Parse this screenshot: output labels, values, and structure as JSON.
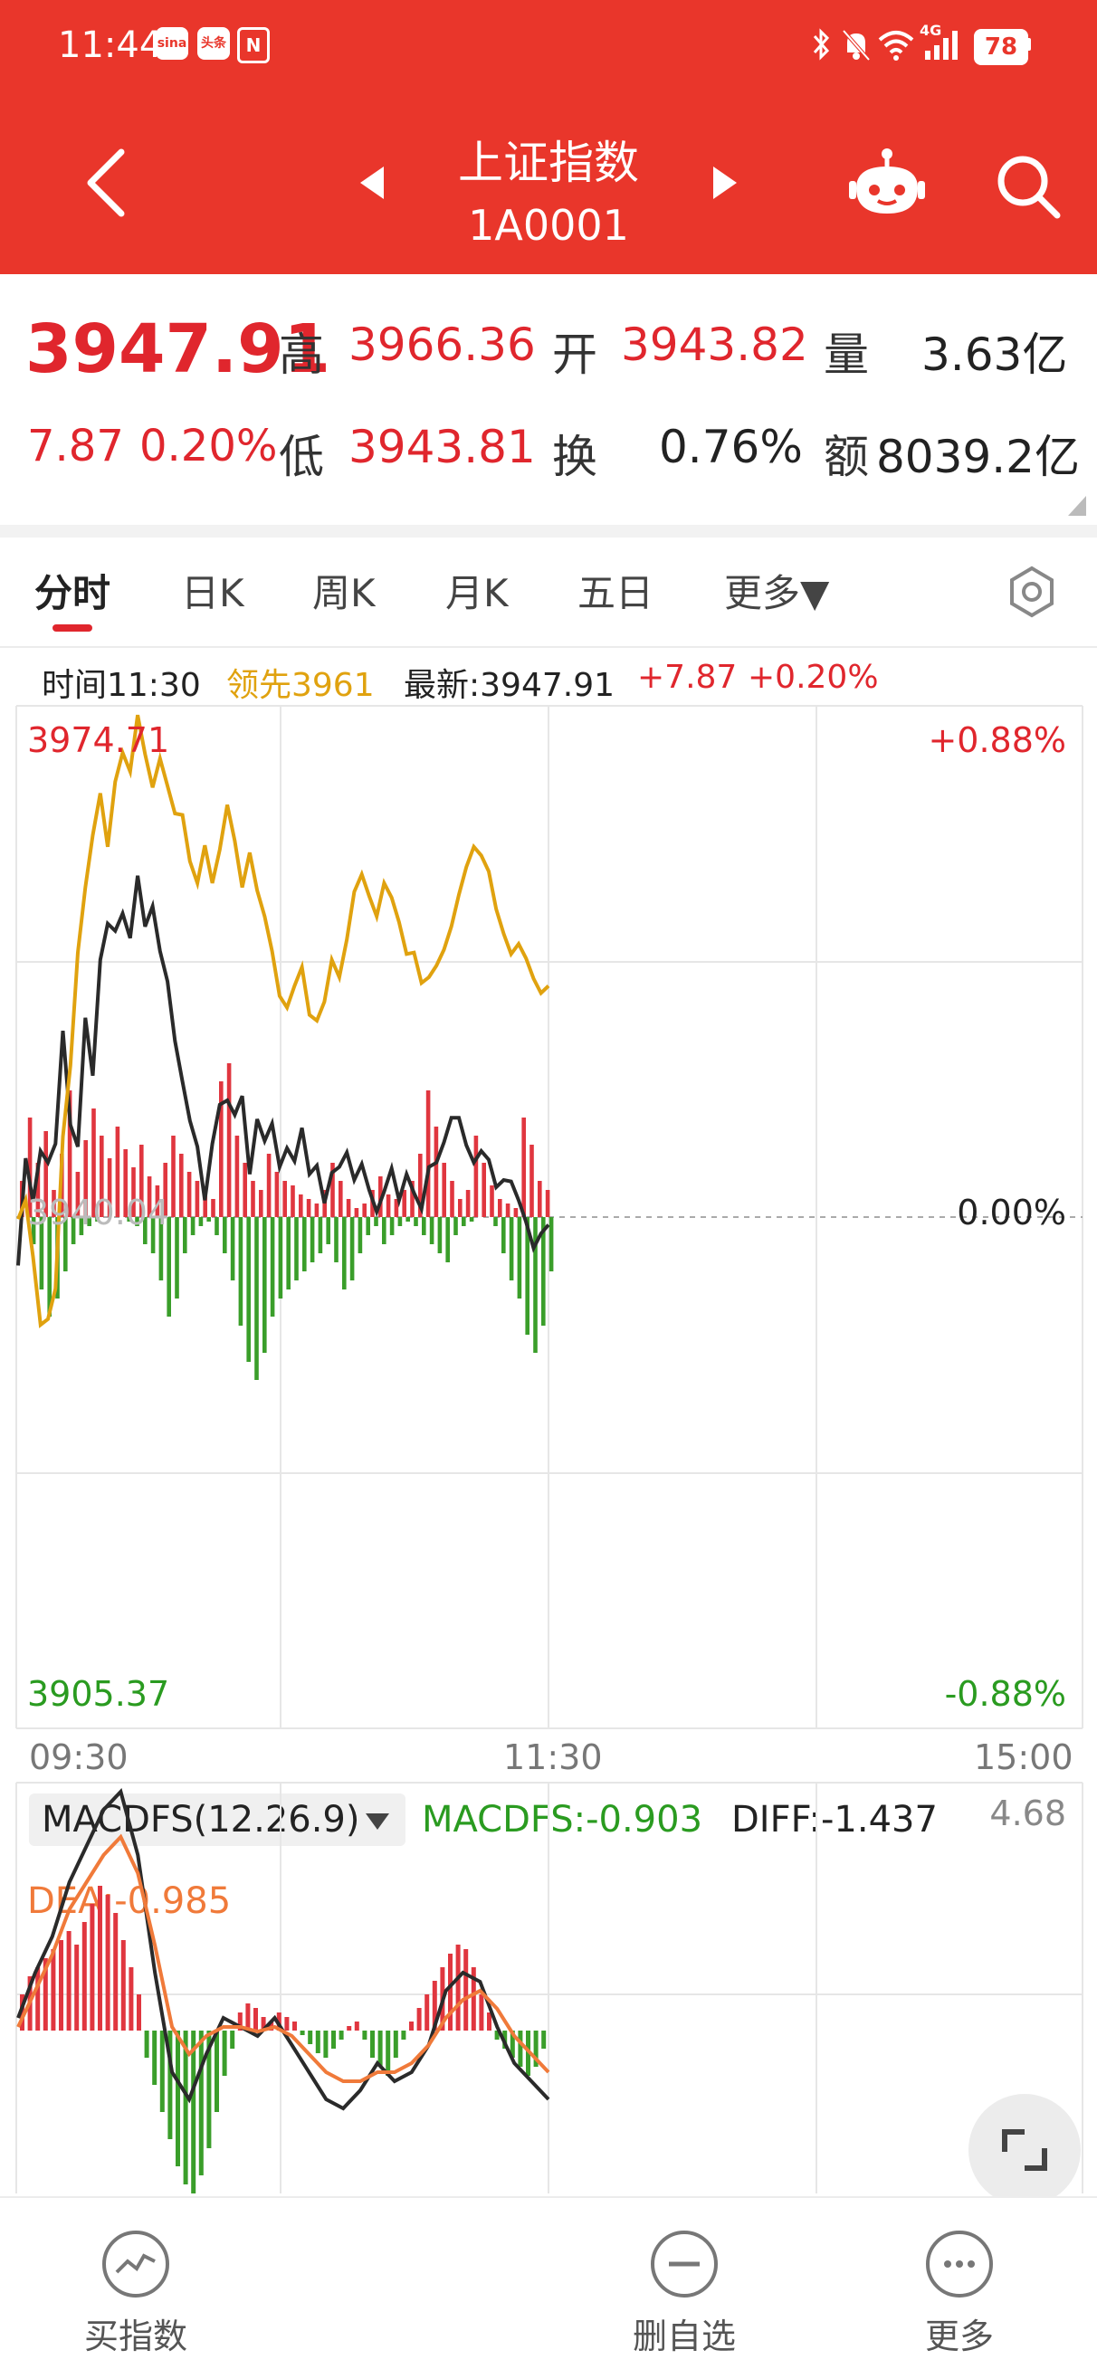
{
  "status_bar": {
    "time": "11:44",
    "app_badges": [
      "sina",
      "头条",
      "N"
    ],
    "battery": "78",
    "network": "4G"
  },
  "header": {
    "title": "上证指数",
    "code": "1A0001",
    "icons": [
      "back-icon",
      "prev-icon",
      "next-icon",
      "robot-icon",
      "search-icon"
    ]
  },
  "quote": {
    "price": "3947.91",
    "change": "7.87",
    "change_pct": "0.20%",
    "high_label": "高",
    "high": "3966.36",
    "open_label": "开",
    "open": "3943.82",
    "volume_label": "量",
    "volume": "3.63亿",
    "low_label": "低",
    "low": "3943.81",
    "turnover_label": "换",
    "turnover": "0.76%",
    "amount_label": "额",
    "amount": "8039.2亿"
  },
  "tabs": [
    {
      "label": "分时",
      "active": true
    },
    {
      "label": "日K"
    },
    {
      "label": "周K"
    },
    {
      "label": "月K"
    },
    {
      "label": "五日"
    },
    {
      "label": "更多▼"
    }
  ],
  "info_line": {
    "time": "时间11:30",
    "lead": "领先3961",
    "latest": "最新:3947.91",
    "change": "+7.87",
    "change_pct": "+0.20%"
  },
  "intraday": {
    "y_top": "3974.71",
    "y_mid": "3940.04",
    "y_bottom": "3905.37",
    "pct_top": "+0.88%",
    "pct_mid": "0.00%",
    "pct_bottom": "-0.88%",
    "x_labels": [
      "09:30",
      "11:30",
      "15:00"
    ]
  },
  "macd": {
    "selector": "MACDFS(12.26.9)",
    "macdfs": "MACDFS:-0.903",
    "diff": "DIFF:-1.437",
    "dea": "DEA:-0.985",
    "max": "4.68"
  },
  "bottom_bar": {
    "buy_index": "买指数",
    "remove_watch": "删自选",
    "more": "更多"
  },
  "colors": {
    "header_red": "#e9362b",
    "up_red": "#e0262d",
    "down_green": "#2a9b20",
    "lead_gold": "#e0a20f",
    "price_line": "#2a2a2a",
    "dea_orange": "#f07a3a"
  },
  "chart_data": {
    "type": "line",
    "x_range": [
      "09:30",
      "15:00"
    ],
    "ylim": [
      3905.37,
      3974.71
    ],
    "base": 3940.04,
    "series": [
      {
        "name": "最新",
        "values": [
          3936.7,
          3944.1,
          3941.1,
          3944.6,
          3943.8,
          3945.1,
          3952.9,
          3946.4,
          3944.9,
          3953.8,
          3949.8,
          3957.8,
          3960.3,
          3959.8,
          3961.0,
          3959.3,
          3963.6,
          3960.1,
          3961.5,
          3958.4,
          3956.3,
          3952.2,
          3949.4,
          3946.7,
          3944.9,
          3941.2,
          3945.1,
          3947.8,
          3948.1,
          3947.1,
          3948.4,
          3943.0,
          3946.8,
          3945.3,
          3946.5,
          3943.5,
          3944.8,
          3943.9,
          3946.2,
          3943.0,
          3943.6,
          3941.0,
          3943.1,
          3943.5,
          3944.5,
          3942.6,
          3943.7,
          3941.9,
          3940.4,
          3941.8,
          3943.4,
          3941.2,
          3943.0,
          3941.7,
          3940.6,
          3943.5,
          3943.8,
          3945.2,
          3946.9,
          3946.9,
          3945.0,
          3943.8,
          3944.6,
          3944.0,
          3942.1,
          3942.6,
          3942.5,
          3941.2,
          3939.7,
          3937.9,
          3938.9,
          3939.5
        ]
      },
      {
        "name": "领先",
        "values": [
          3939.9,
          3941.2,
          3937.3,
          3932.6,
          3933.0,
          3935.1,
          3945.6,
          3950.5,
          3958.3,
          3962.8,
          3966.4,
          3969.3,
          3965.6,
          3970.1,
          3972.1,
          3970.8,
          3974.7,
          3972.0,
          3969.7,
          3971.7,
          3969.8,
          3967.9,
          3967.8,
          3964.6,
          3963.1,
          3965.7,
          3963.1,
          3965.4,
          3968.5,
          3966.0,
          3962.8,
          3965.2,
          3962.6,
          3960.8,
          3958.4,
          3955.3,
          3954.5,
          3956.0,
          3957.3,
          3954.0,
          3953.6,
          3954.9,
          3957.8,
          3956.6,
          3959.2,
          3962.5,
          3963.7,
          3962.2,
          3960.8,
          3963.1,
          3962.1,
          3960.4,
          3958.2,
          3958.3,
          3956.2,
          3956.6,
          3957.4,
          3958.5,
          3960.1,
          3962.3,
          3964.2,
          3965.6,
          3965.0,
          3963.9,
          3961.3,
          3959.6,
          3958.2,
          3958.9,
          3957.9,
          3956.5,
          3955.5,
          3956.0
        ]
      }
    ]
  }
}
